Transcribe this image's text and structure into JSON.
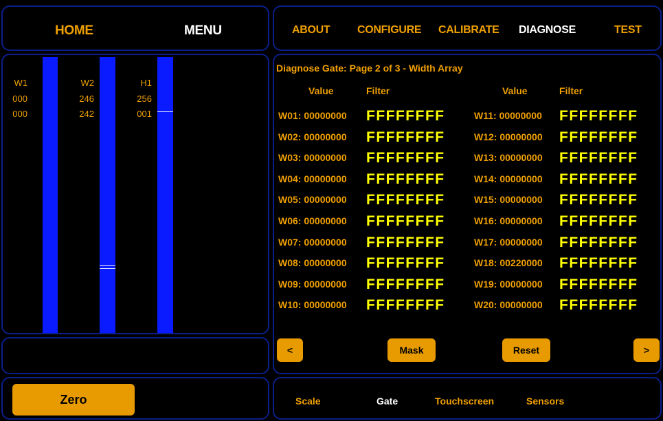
{
  "top_left_nav": {
    "home": "HOME",
    "menu": "MENU"
  },
  "top_right_nav": {
    "about": "ABOUT",
    "configure": "CONFIGURE",
    "calibrate": "CALIBRATE",
    "diagnose": "DIAGNOSE",
    "test": "TEST"
  },
  "bars": [
    {
      "name": "W1",
      "value1": "000",
      "value2": "000"
    },
    {
      "name": "W2",
      "value1": "246",
      "value2": "242"
    },
    {
      "name": "H1",
      "value1": "256",
      "value2": "001"
    }
  ],
  "zero_label": "Zero",
  "diagnose": {
    "title": "Diagnose Gate: Page 2 of 3 -  Width Array",
    "value_header": "Value",
    "filter_header": "Filter",
    "left_rows": [
      {
        "label": "W01: 00000000",
        "filter": "FFFFFFFF"
      },
      {
        "label": "W02: 00000000",
        "filter": "FFFFFFFF"
      },
      {
        "label": "W03: 00000000",
        "filter": "FFFFFFFF"
      },
      {
        "label": "W04: 00000000",
        "filter": "FFFFFFFF"
      },
      {
        "label": "W05: 00000000",
        "filter": "FFFFFFFF"
      },
      {
        "label": "W06: 00000000",
        "filter": "FFFFFFFF"
      },
      {
        "label": "W07: 00000000",
        "filter": "FFFFFFFF"
      },
      {
        "label": "W08: 00000000",
        "filter": "FFFFFFFF"
      },
      {
        "label": "W09: 00000000",
        "filter": "FFFFFFFF"
      },
      {
        "label": "W10: 00000000",
        "filter": "FFFFFFFF"
      }
    ],
    "right_rows": [
      {
        "label": "W11: 00000000",
        "filter": "FFFFFFFF"
      },
      {
        "label": "W12: 00000000",
        "filter": "FFFFFFFF"
      },
      {
        "label": "W13: 00000000",
        "filter": "FFFFFFFF"
      },
      {
        "label": "W14: 00000000",
        "filter": "FFFFFFFF"
      },
      {
        "label": "W15: 00000000",
        "filter": "FFFFFFFF"
      },
      {
        "label": "W16: 00000000",
        "filter": "FFFFFFFF"
      },
      {
        "label": "W17: 00000000",
        "filter": "FFFFFFFF"
      },
      {
        "label": "W18: 00220000",
        "filter": "FFFFFFFF"
      },
      {
        "label": "W19: 00000000",
        "filter": "FFFFFFFF"
      },
      {
        "label": "W20: 00000000",
        "filter": "FFFFFFFF"
      }
    ]
  },
  "buttons": {
    "prev": "<",
    "mask": "Mask",
    "reset": "Reset",
    "next": ">"
  },
  "bottom_tabs": {
    "scale": "Scale",
    "gate": "Gate",
    "touchscreen": "Touchscreen",
    "sensors": "Sensors"
  },
  "colors": {
    "accent": "#f0a000",
    "active": "#ffffff",
    "filter": "#ffff00",
    "bar": "#0a1cff",
    "border": "#0b1f8a"
  }
}
